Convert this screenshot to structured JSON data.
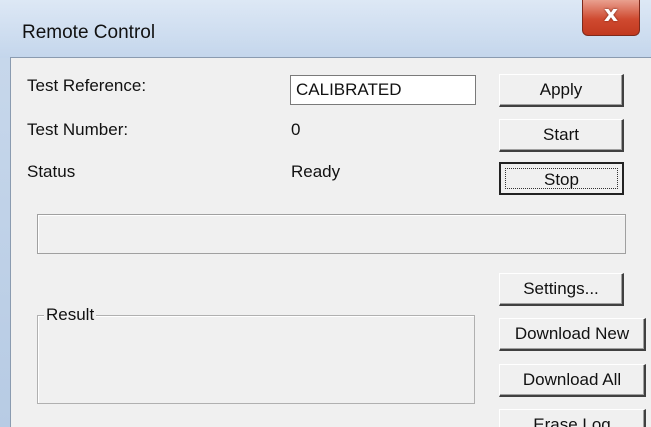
{
  "window": {
    "title": "Remote Control",
    "close_symbol": "x"
  },
  "fields": {
    "test_reference": {
      "label": "Test Reference:",
      "value": "CALIBRATED"
    },
    "test_number": {
      "label": "Test Number:",
      "value": "0"
    },
    "status": {
      "label": "Status",
      "value": "Ready"
    }
  },
  "buttons": {
    "apply": "Apply",
    "start": "Start",
    "stop": "Stop",
    "settings": "Settings...",
    "download_new": "Download New",
    "download_all": "Download All",
    "erase_log": "Erase Log"
  },
  "progress": {
    "fraction": 0
  },
  "result": {
    "legend": "Result"
  }
}
